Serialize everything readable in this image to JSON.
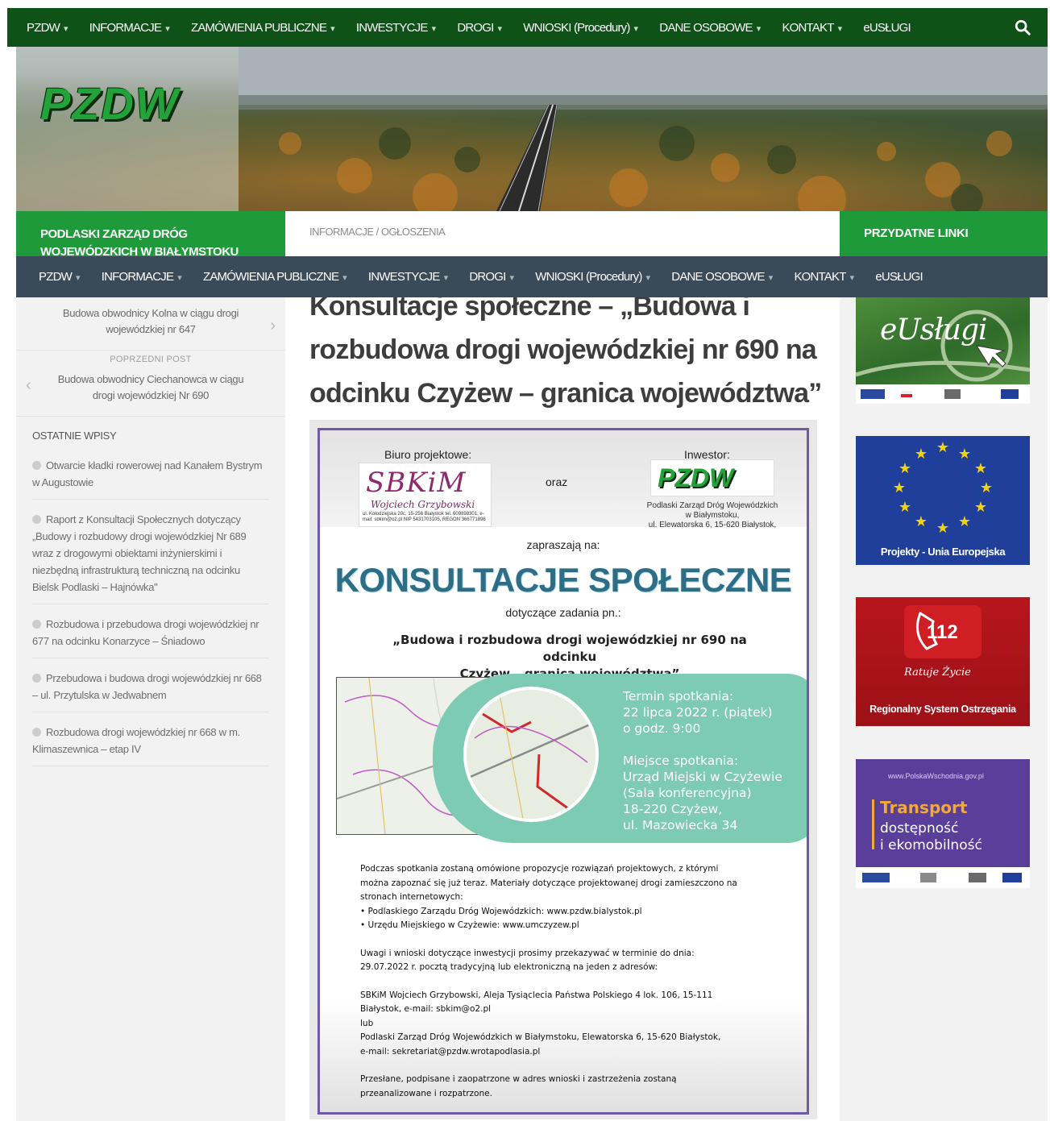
{
  "topnav": {
    "items": [
      "PZDW",
      "INFORMACJE",
      "ZAMÓWIENIA PUBLICZNE",
      "INWESTYCJE",
      "DROGI",
      "WNIOSKI (Procedury)",
      "DANE OSOBOWE",
      "KONTAKT",
      "eUSŁUGI"
    ],
    "search_icon": "search-icon"
  },
  "header": {
    "logo_text": "PZDW"
  },
  "band": {
    "org_name_line1": "PODLASKI ZARZĄD DRÓG",
    "org_name_line2": "WOJEWÓDZKICH W BIAŁYMSTOKU",
    "breadcrumb": "INFORMACJE / OGŁOSZENIA",
    "useful_links": "PRZYDATNE LINKI"
  },
  "subnav": {
    "items": [
      "PZDW",
      "INFORMACJE",
      "ZAMÓWIENIA PUBLICZNE",
      "INWESTYCJE",
      "DROGI",
      "WNIOSKI (Procedury)",
      "DANE OSOBOWE",
      "KONTAKT",
      "eUSŁUGI"
    ]
  },
  "sidebar": {
    "next_post_line1": "Budowa obwodnicy Kolna w ciągu drogi",
    "next_post_line2": "wojewódzkiej nr 647",
    "prev_label": "POPRZEDNI POST",
    "prev_post_line1": "Budowa obwodnicy Ciechanowca w ciągu",
    "prev_post_line2": "drogi wojewódzkiej Nr 690",
    "recent_title": "OSTATNIE WPISY",
    "recent": [
      "Otwarcie kładki rowerowej nad Kanałem Bystrym w Augustowie",
      "Raport z Konsultacji Społecznych dotyczący „Budowy i rozbudowy drogi wojewódzkiej Nr 689 wraz z drogowymi obiektami inżynierskimi i niezbędną infrastrukturą techniczną na odcinku Bielsk Podlaski – Hajnówka\"",
      "Rozbudowa i przebudowa drogi wojewódzkiej nr 677 na odcinku Konarzyce – Śniadowo",
      "Przebudowa i budowa drogi wojewódzkiej nr 668 – ul. Przytulska w Jedwabnem",
      "Rozbudowa drogi wojewódzkiej nr 668 w m. Klimaszewnica – etap IV"
    ]
  },
  "main": {
    "title": "Konsultacje społeczne – „Budowa i rozbudowa drogi wojewódzkiej nr 690 na odcinku Czyżew – granica województwa”",
    "poster": {
      "bureau_label": "Biuro projektowe:",
      "investor_label": "Inwestor:",
      "and_label": "oraz",
      "sbkim_name": "SBKiM",
      "sbkim_owner": "Wojciech Grzybowski",
      "sbkim_address": "ul. Kołodziejska 20c, 15-256 Białystok tel. 609898301, e-mail: sbkim@o2.pl NIP 5431703105, REGON 366771896",
      "pzdw_logo": "PZDW",
      "investor_address_1": "Podlaski Zarząd Dróg Wojewódzkich",
      "investor_address_2": "w Białymstoku,",
      "investor_address_3": "ul. Elewatorska 6, 15-620 Białystok,",
      "invite": "zapraszają na:",
      "headline": "KONSULTACJE SPOŁECZNE",
      "concerning": "dotyczące zadania pn.:",
      "task_line1": "„Budowa i rozbudowa drogi wojewódzkiej nr 690 na odcinku",
      "task_line2": "Czyżew – granica województwa”",
      "meeting_term_label": "Termin spotkania:",
      "meeting_date": "22 lipca 2022 r. (piątek)",
      "meeting_time": "o godz. 9:00",
      "meeting_place_label": "Miejsce spotkania:",
      "place_line1": "Urząd Miejski w Czyżewie",
      "place_line2": "(Sala konferencyjna)",
      "place_line3": "18-220 Czyżew,",
      "place_line4": "ul. Mazowiecka 34",
      "p1_l1": "Podczas spotkania zostaną omówione propozycje rozwiązań projektowych, z którymi",
      "p1_l2": "można zapoznać się już teraz. Materiały dotyczące projektowanej drogi zamieszczono na",
      "p1_l3": "stronach internetowych:",
      "p1_l4": "• Podlaskiego Zarządu Dróg Wojewódzkich: www.pzdw.bialystok.pl",
      "p1_l5": "• Urzędu Miejskiego w Czyżewie: www.umczyzew.pl",
      "p2_l1": "Uwagi i wnioski dotyczące inwestycji prosimy przekazywać w terminie do dnia:",
      "p2_l2": "29.07.2022 r. pocztą tradycyjną lub elektroniczną na jeden z adresów:",
      "p3_l1": "SBKiM Wojciech Grzybowski, Aleja Tysiąclecia Państwa Polskiego 4 lok. 106, 15-111",
      "p3_l2": "Białystok, e-mail: sbkim@o2.pl",
      "p3_l3": "lub",
      "p3_l4": "Podlaski Zarząd Dróg Wojewódzkich w Białymstoku, Elewatorska 6,  15-620 Białystok,",
      "p3_l5": "e-mail: sekretariat@pzdw.wrotapodlasia.pl",
      "p4_l1": "Przesłane, podpisane i zaopatrzone w adres wnioski i zastrzeżenia zostaną",
      "p4_l2": "przeanalizowane i rozpatrzone."
    }
  },
  "right": {
    "eus_caption": "eUsługi",
    "union_caption": "Projekty - Unia Europejska",
    "rso_number": "112",
    "rso_script": "Ratuje Życie",
    "rso_caption": "Regionalny System Ostrzegania",
    "transport_url": "www.PolskaWschodnia.gov.pl",
    "transport_title": "Transport",
    "transport_line2": "dostępność",
    "transport_line3": "i ekomobilność"
  },
  "colors": {
    "topnav_bg": "#0e5218",
    "green_band": "#1f9a3b",
    "subnav_bg": "#3a4a58",
    "sidebar_bg": "#f2f2f2"
  }
}
